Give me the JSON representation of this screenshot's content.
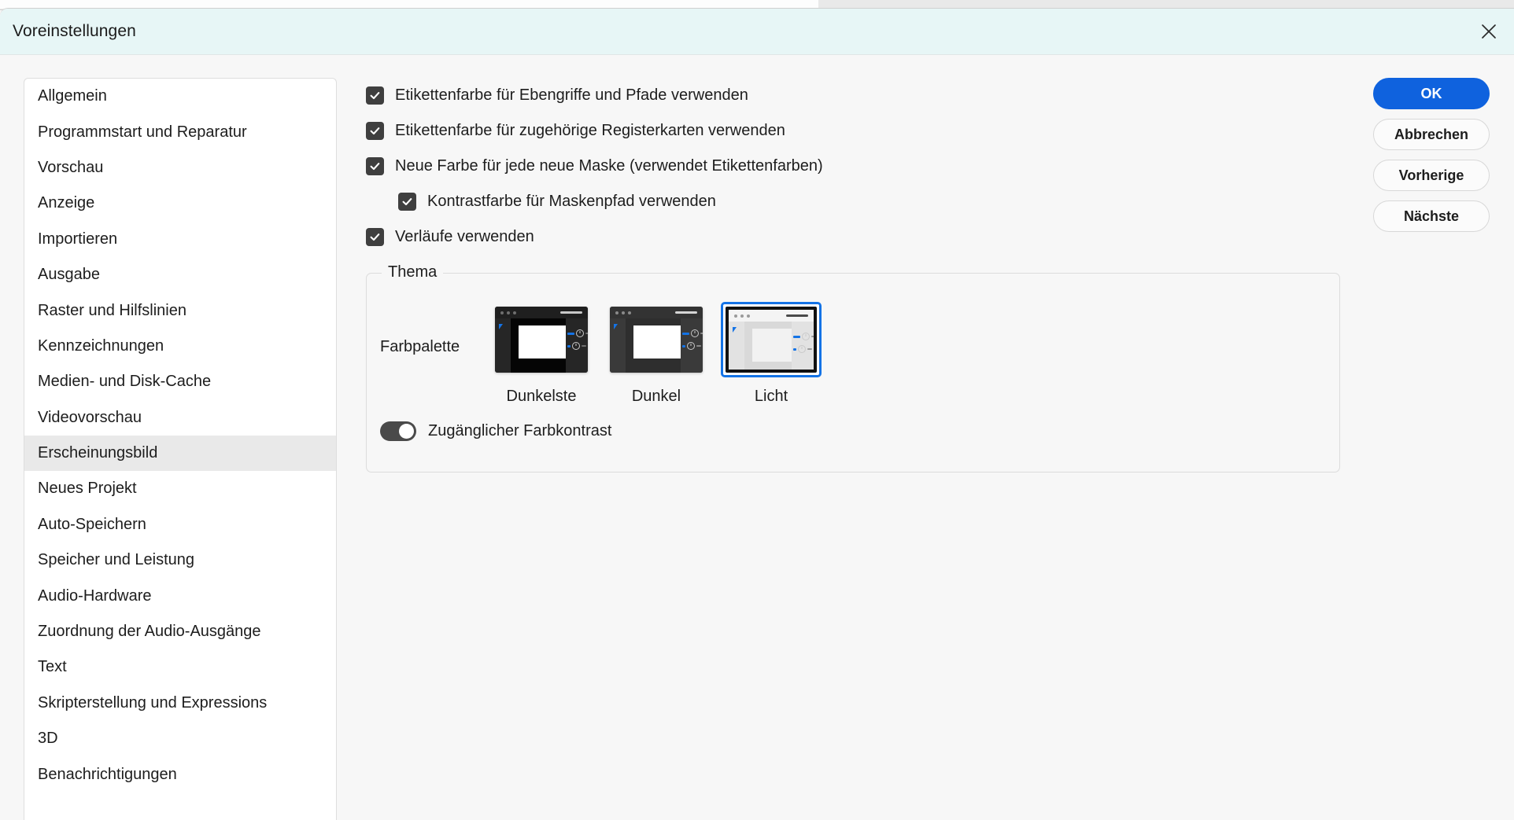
{
  "window": {
    "title": "Voreinstellungen",
    "close_icon": "close-icon"
  },
  "sidebar": {
    "items": [
      {
        "label": "Allgemein",
        "selected": false
      },
      {
        "label": "Programmstart und Reparatur",
        "selected": false
      },
      {
        "label": "Vorschau",
        "selected": false
      },
      {
        "label": "Anzeige",
        "selected": false
      },
      {
        "label": "Importieren",
        "selected": false
      },
      {
        "label": "Ausgabe",
        "selected": false
      },
      {
        "label": "Raster und Hilfslinien",
        "selected": false
      },
      {
        "label": "Kennzeichnungen",
        "selected": false
      },
      {
        "label": "Medien- und Disk-Cache",
        "selected": false
      },
      {
        "label": "Videovorschau",
        "selected": false
      },
      {
        "label": "Erscheinungsbild",
        "selected": true
      },
      {
        "label": "Neues Projekt",
        "selected": false
      },
      {
        "label": "Auto-Speichern",
        "selected": false
      },
      {
        "label": "Speicher und Leistung",
        "selected": false
      },
      {
        "label": "Audio-Hardware",
        "selected": false
      },
      {
        "label": "Zuordnung der Audio-Ausgänge",
        "selected": false
      },
      {
        "label": "Text",
        "selected": false
      },
      {
        "label": "Skripterstellung und Expressions",
        "selected": false
      },
      {
        "label": "3D",
        "selected": false
      },
      {
        "label": "Benachrichtigungen",
        "selected": false
      }
    ]
  },
  "settings": {
    "checkboxes": [
      {
        "label": "Etikettenfarbe für Ebengriffe und Pfade verwenden",
        "checked": true,
        "indented": false
      },
      {
        "label": "Etikettenfarbe für zugehörige Registerkarten verwenden",
        "checked": true,
        "indented": false
      },
      {
        "label": "Neue Farbe für jede neue Maske (verwendet Etikettenfarben)",
        "checked": true,
        "indented": false
      },
      {
        "label": "Kontrastfarbe für Maskenpfad verwenden",
        "checked": true,
        "indented": true
      },
      {
        "label": "Verläufe verwenden",
        "checked": true,
        "indented": false
      }
    ]
  },
  "theme_group": {
    "title": "Thema",
    "palette_label": "Farbpalette",
    "options": [
      {
        "label": "Dunkelste",
        "selected": false,
        "chrome": "#262626",
        "panel": "#050505",
        "screen": "#ffffff",
        "topbar": "#1f1f1f",
        "dot": "#6e6e6e",
        "slider": "#c8c8c8",
        "rail": "#262626"
      },
      {
        "label": "Dunkel",
        "selected": false,
        "chrome": "#3a3a3a",
        "panel": "#2e2e2e",
        "screen": "#ffffff",
        "topbar": "#333333",
        "dot": "#8a8a8a",
        "slider": "#d5d5d5",
        "rail": "#3a3a3a"
      },
      {
        "label": "Licht",
        "selected": true,
        "chrome": "#e2e2e2",
        "panel": "#d9d9d9",
        "screen": "#f2f2f2",
        "topbar": "#f4f4f4",
        "dot": "#9a9a9a",
        "slider": "#4a4a4a",
        "rail": "#ffffff"
      }
    ],
    "accessible_contrast": {
      "label": "Zugänglicher Farbkontrast",
      "enabled": true
    }
  },
  "buttons": [
    {
      "label": "OK",
      "style": "primary"
    },
    {
      "label": "Abbrechen",
      "style": "secondary"
    },
    {
      "label": "Vorherige",
      "style": "secondary"
    },
    {
      "label": "Nächste",
      "style": "secondary"
    }
  ],
  "colors": {
    "accent_blue": "#0f62de",
    "selection_blue": "#1473e6",
    "titlebar_tint": "#e7f6f6",
    "checkbox_fill": "#3f3f3f",
    "toggle_on": "#4a4a4a",
    "sidebar_selected": "#e9e9e9"
  }
}
